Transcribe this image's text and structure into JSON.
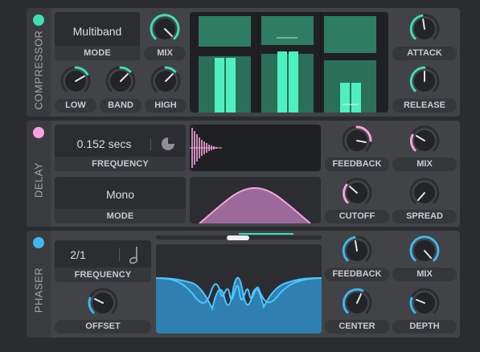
{
  "compressor": {
    "title": "COMPRESSOR",
    "mode_value": "Multiband",
    "mode_label": "MODE",
    "mix_label": "MIX",
    "low_label": "LOW",
    "band_label": "BAND",
    "high_label": "HIGH",
    "attack_label": "ATTACK",
    "release_label": "RELEASE",
    "accent": "#3de0b0"
  },
  "delay": {
    "title": "DELAY",
    "frequency_value": "0.152 secs",
    "frequency_label": "FREQUENCY",
    "mode_value": "Mono",
    "mode_label": "MODE",
    "feedback_label": "FEEDBACK",
    "mix_label": "MIX",
    "cutoff_label": "CUTOFF",
    "spread_label": "SPREAD",
    "accent": "#f5a3dd"
  },
  "phaser": {
    "title": "PHASER",
    "frequency_value": "2/1",
    "frequency_label": "FREQUENCY",
    "offset_label": "OFFSET",
    "feedback_label": "FEEDBACK",
    "mix_label": "MIX",
    "center_label": "CENTER",
    "depth_label": "DEPTH",
    "accent": "#3fb7ee"
  },
  "icons": [
    "tempo-sync-icon",
    "quarter-note-icon"
  ]
}
